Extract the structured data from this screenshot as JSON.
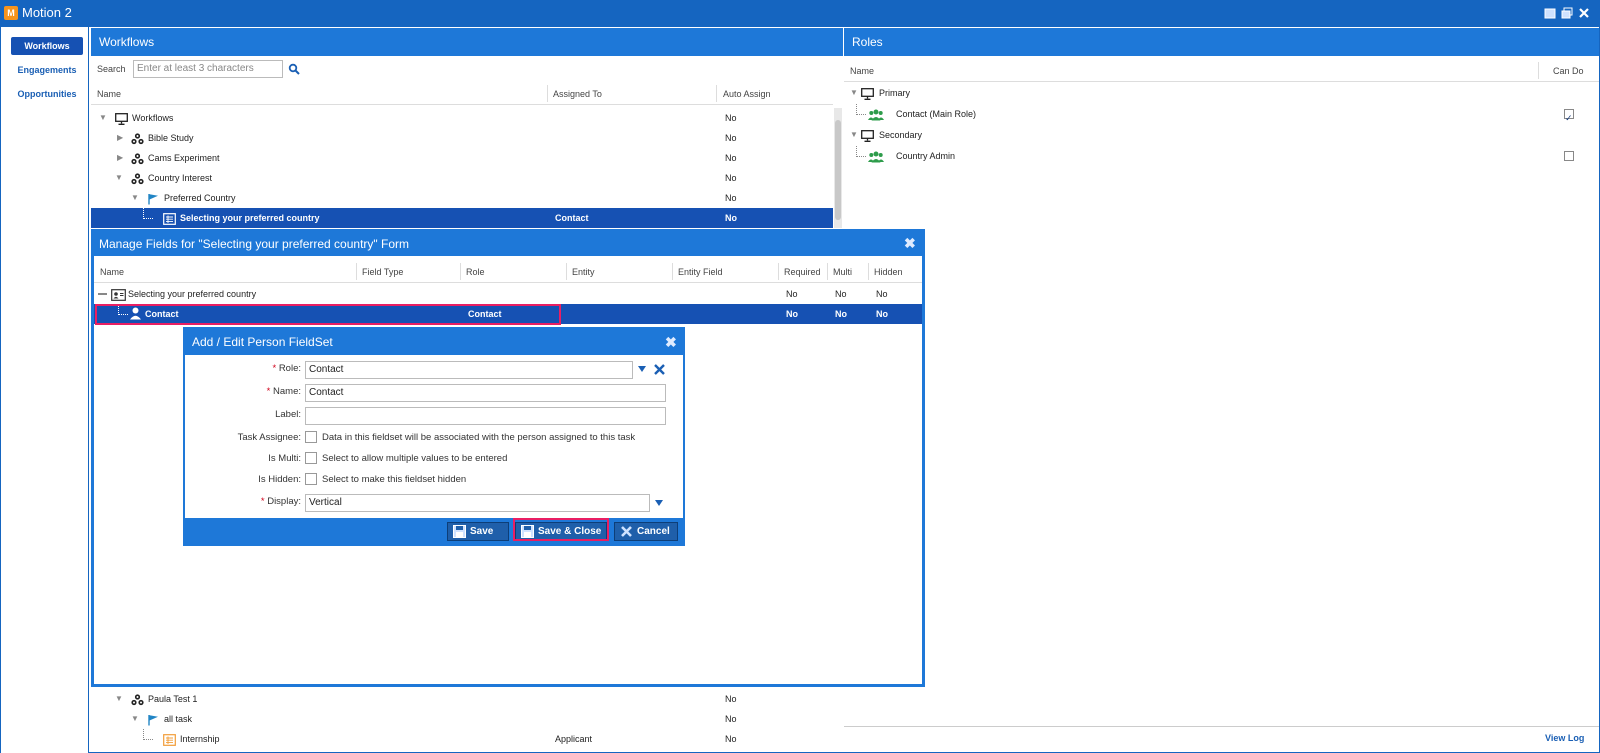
{
  "app": {
    "title": "Motion 2",
    "logo_letter": "M"
  },
  "window_controls": [
    "minimize-icon",
    "restore-icon",
    "close-icon"
  ],
  "nav": {
    "items": [
      {
        "label": "Workflows",
        "active": true
      },
      {
        "label": "Engagements",
        "active": false
      },
      {
        "label": "Opportunities",
        "active": false
      }
    ]
  },
  "workflows": {
    "title": "Workflows",
    "search": {
      "label": "Search",
      "placeholder": "Enter at least 3 characters"
    },
    "columns": [
      "Name",
      "Assigned To",
      "Auto Assign"
    ],
    "rows": [
      {
        "name": "Workflows",
        "assigned": "",
        "auto": "No",
        "icon": "monitor-icon",
        "expand": "open"
      },
      {
        "name": "Bible Study",
        "assigned": "",
        "auto": "No",
        "icon": "workflow-icon",
        "expand": "closed"
      },
      {
        "name": "Cams Experiment",
        "assigned": "",
        "auto": "No",
        "icon": "workflow-icon",
        "expand": "closed"
      },
      {
        "name": "Country Interest",
        "assigned": "",
        "auto": "No",
        "icon": "workflow-icon",
        "expand": "open"
      },
      {
        "name": "Preferred Country",
        "assigned": "",
        "auto": "No",
        "icon": "flag-icon",
        "expand": "open"
      },
      {
        "name": "Selecting your preferred country",
        "assigned": "Contact",
        "auto": "No",
        "icon": "form-icon",
        "expand": "none",
        "selected": true
      }
    ],
    "bottom_rows": [
      {
        "name": "Paula Test 1",
        "assigned": "",
        "auto": "No",
        "icon": "workflow-icon",
        "expand": "open"
      },
      {
        "name": "all task",
        "assigned": "",
        "auto": "No",
        "icon": "flag-icon",
        "expand": "open"
      },
      {
        "name": "Internship",
        "assigned": "Applicant",
        "auto": "No",
        "icon": "form-icon",
        "expand": "none"
      }
    ]
  },
  "roles": {
    "title": "Roles",
    "columns": [
      "Name",
      "Can Do"
    ],
    "rows": [
      {
        "name": "Primary",
        "type": "group",
        "icon": "monitor-icon"
      },
      {
        "name": "Contact (Main Role)",
        "type": "role",
        "icon": "people-icon",
        "can_do": true
      },
      {
        "name": "Secondary",
        "type": "group",
        "icon": "monitor-icon"
      },
      {
        "name": "Country Admin",
        "type": "role",
        "icon": "people-icon",
        "can_do": false
      }
    ],
    "view_log": "View Log"
  },
  "manage_fields": {
    "title": "Manage Fields for \"Selecting your preferred country\" Form",
    "columns": [
      "Name",
      "Field Type",
      "Role",
      "Entity",
      "Entity Field",
      "Required",
      "Multi",
      "Hidden"
    ],
    "rows": [
      {
        "name": "Selecting your preferred country",
        "field_type": "",
        "role": "",
        "entity": "",
        "entity_field": "",
        "required": "No",
        "multi": "No",
        "hidden": "No"
      },
      {
        "name": "Contact",
        "field_type": "",
        "role": "Contact",
        "entity": "",
        "entity_field": "",
        "required": "No",
        "multi": "No",
        "hidden": "No",
        "selected": true
      }
    ]
  },
  "edit_dialog": {
    "title": "Add / Edit Person FieldSet",
    "role_label": "Role:",
    "role_value": "Contact",
    "name_label": "Name:",
    "name_value": "Contact",
    "label_label": "Label:",
    "label_value": "",
    "task_assignee_label": "Task Assignee:",
    "task_assignee_text": "Data in this fieldset will be associated with the person assigned to this task",
    "is_multi_label": "Is Multi:",
    "is_multi_text": "Select to allow multiple values to be entered",
    "is_hidden_label": "Is Hidden:",
    "is_hidden_text": "Select to make this fieldset hidden",
    "display_label": "Display:",
    "display_value": "Vertical",
    "buttons": {
      "save": "Save",
      "save_close": "Save & Close",
      "cancel": "Cancel"
    }
  },
  "colors": {
    "brand": "#1e78d8",
    "selection": "#1651b3",
    "highlight": "#e91e63",
    "people_icon": "#2e9c4b",
    "flag_icon": "#2185c5"
  }
}
